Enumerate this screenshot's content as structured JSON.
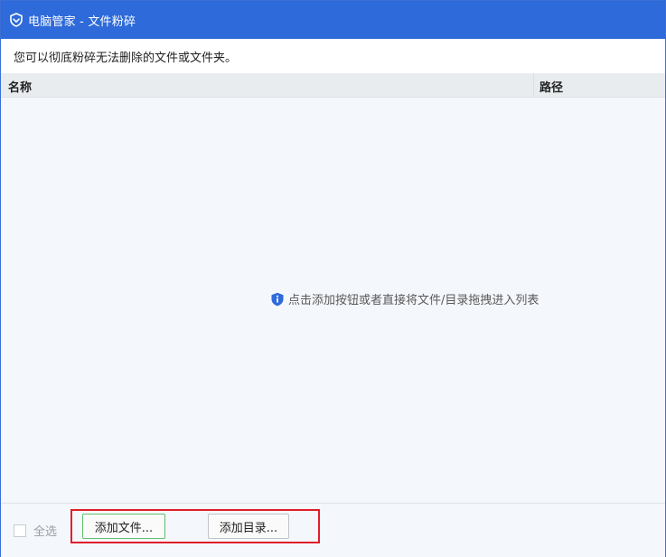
{
  "window": {
    "title": "电脑管家 - 文件粉碎",
    "accent_color": "#2e6ad9"
  },
  "description": "您可以彻底粉碎无法删除的文件或文件夹。",
  "table": {
    "columns": [
      "名称",
      "路径"
    ],
    "rows": [],
    "empty_hint": "点击添加按钮或者直接将文件/目录拖拽进入列表",
    "empty_icon": "shield-info-icon"
  },
  "footer": {
    "select_all_label": "全选",
    "select_all_checked": false,
    "add_file_label": "添加文件...",
    "add_dir_label": "添加目录...",
    "highlight_color": "#e01e2a"
  }
}
